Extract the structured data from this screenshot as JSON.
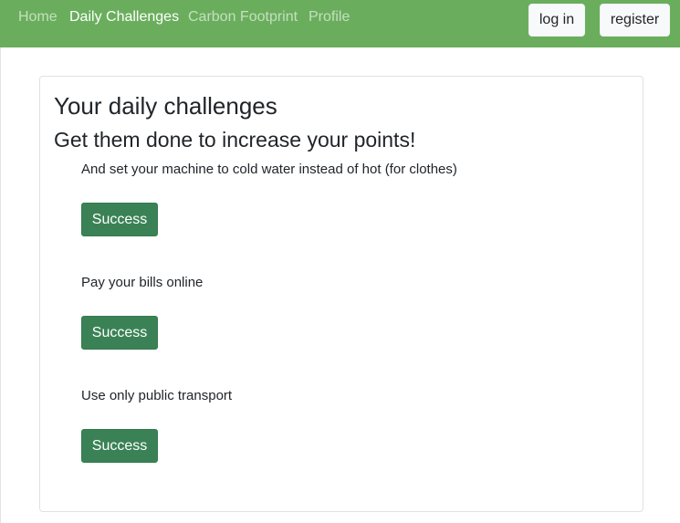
{
  "navbar": {
    "links": [
      {
        "label": "Home",
        "active": false
      },
      {
        "label": "Daily Challenges",
        "active": true
      },
      {
        "label": "Carbon Footprint",
        "active": false
      },
      {
        "label": "Profile",
        "active": false
      }
    ],
    "login_label": "log in",
    "register_label": "register",
    "background_color": "#6aae5d"
  },
  "main": {
    "title": "Your daily challenges",
    "subtitle": "Get them done to increase your points!",
    "challenges": [
      {
        "text": "And set your machine to cold water instead of hot (for clothes)",
        "button_label": "Success"
      },
      {
        "text": "Pay your bills online",
        "button_label": "Success"
      },
      {
        "text": "Use only public transport",
        "button_label": "Success"
      }
    ],
    "button_color": "#3a8256"
  }
}
